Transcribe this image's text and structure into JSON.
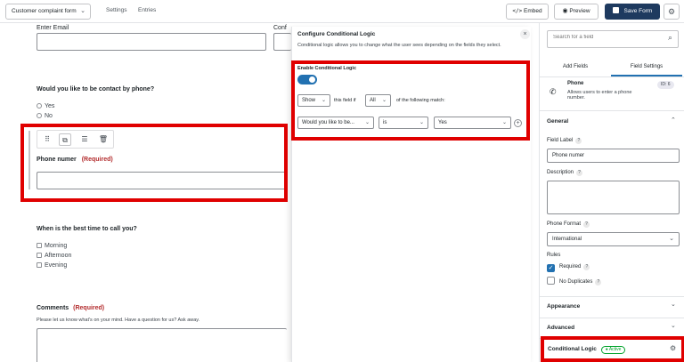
{
  "topbar": {
    "form_name": "Customer complaint form",
    "nav": [
      "Settings",
      "Entries"
    ],
    "embed_label": "Embed",
    "preview_label": "Preview",
    "save_label": "Save Form"
  },
  "form": {
    "email_label": "Enter Email",
    "conf_label": "Conf",
    "contact_question": "Would you like to be contact by phone?",
    "contact_options": [
      "Yes",
      "No"
    ],
    "phone_label": "Phone numer",
    "required_tag": "(Required)",
    "time_question": "When is the best time to call you?",
    "time_options": [
      "Morning",
      "Afternoon",
      "Evening"
    ],
    "comments_label": "Comments",
    "comments_required": "(Required)",
    "comments_desc": "Please let us know what's on your mind. Have a question for us? Ask away."
  },
  "logic_popup": {
    "title": "Configure Conditional Logic",
    "description": "Conditional logic allows you to change what the user sees depending on the fields they select.",
    "enable_label": "Enable Conditional Logic",
    "action_value": "Show",
    "this_field_if": "this field if",
    "match_value": "All",
    "following_match": "of the following match:",
    "rule_field": "Would you like to be...",
    "rule_operator": "is",
    "rule_value": "Yes"
  },
  "right_panel": {
    "search_placeholder": "Search for a field",
    "tabs": [
      "Add Fields",
      "Field Settings"
    ],
    "field_name": "Phone",
    "field_desc": "Allows users to enter a phone number.",
    "field_id": "ID: 6",
    "general_label": "General",
    "field_label_label": "Field Label",
    "field_label_value": "Phone numer",
    "description_label": "Description",
    "phone_format_label": "Phone Format",
    "phone_format_value": "International",
    "rules_label": "Rules",
    "required_label": "Required",
    "no_duplicates_label": "No Duplicates",
    "appearance_label": "Appearance",
    "advanced_label": "Advanced",
    "conditional_logic_label": "Conditional Logic",
    "active_badge": "Active"
  },
  "colors": {
    "accent": "#2271b1",
    "save_button": "#1e3a5f",
    "highlight": "#e00000",
    "required": "#b32d2e",
    "active_badge": "#00a32a"
  },
  "icons": [
    "chevron-down-icon",
    "code-icon",
    "eye-icon",
    "save-icon",
    "gear-icon",
    "drag-handle-icon",
    "duplicate-icon",
    "sliders-icon",
    "trash-icon",
    "close-icon",
    "plus-icon",
    "search-icon",
    "phone-icon",
    "chevron-up-icon",
    "check-icon"
  ]
}
